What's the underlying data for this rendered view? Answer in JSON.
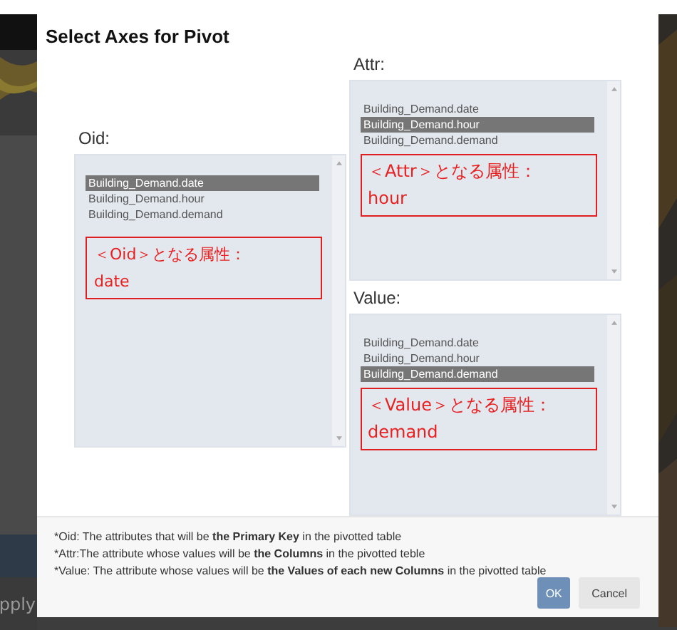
{
  "background": {
    "button_label": "pply"
  },
  "dialog": {
    "title": "Select Axes for Pivot",
    "axes": [
      {
        "label": "Oid:",
        "options": [
          {
            "text": "Building_Demand.date",
            "selected": true
          },
          {
            "text": "Building_Demand.hour",
            "selected": false
          },
          {
            "text": "Building_Demand.demand",
            "selected": false
          }
        ],
        "annotation": "＜Oid＞となる属性：\ndate"
      },
      {
        "label": "Attr:",
        "options": [
          {
            "text": "Building_Demand.date",
            "selected": false
          },
          {
            "text": "Building_Demand.hour",
            "selected": true
          },
          {
            "text": "Building_Demand.demand",
            "selected": false
          }
        ],
        "annotation": "＜Attr＞となる属性：\nhour"
      },
      {
        "label": "Value:",
        "options": [
          {
            "text": "Building_Demand.date",
            "selected": false
          },
          {
            "text": "Building_Demand.hour",
            "selected": false
          },
          {
            "text": "Building_Demand.demand",
            "selected": true
          }
        ],
        "annotation": "＜Value＞となる属性：\ndemand"
      }
    ],
    "notes": [
      "*Oid: The attributes that will be **the Primary Key** in the pivotted table",
      "*Attr:The attribute whose values will be **the Columns** in the pivotted teble",
      "*Value: The attribute whose values will be **the Values of each new Columns** in the pivotted table"
    ],
    "buttons": [
      {
        "label": "OK",
        "kind": "primary"
      },
      {
        "label": "Cancel",
        "kind": "secondary"
      }
    ]
  }
}
